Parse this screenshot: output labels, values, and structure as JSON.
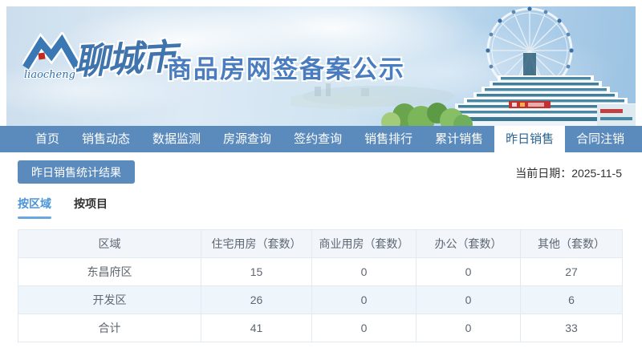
{
  "banner": {
    "logo_script": "liaocheng",
    "brand": "聊城市",
    "title": "商品房网签备案公示"
  },
  "nav": {
    "items": [
      {
        "label": "首页",
        "active": false
      },
      {
        "label": "销售动态",
        "active": false
      },
      {
        "label": "数据监测",
        "active": false
      },
      {
        "label": "房源查询",
        "active": false
      },
      {
        "label": "签约查询",
        "active": false
      },
      {
        "label": "销售排行",
        "active": false
      },
      {
        "label": "累计销售",
        "active": false
      },
      {
        "label": "昨日销售",
        "active": true
      },
      {
        "label": "合同注销",
        "active": false
      }
    ]
  },
  "content": {
    "section_title": "昨日销售统计结果",
    "date_label": "当前日期：",
    "date_value": "2025-11-5",
    "tabs": [
      {
        "label": "按区域",
        "active": true
      },
      {
        "label": "按项目",
        "active": false
      }
    ]
  },
  "table": {
    "headers": [
      "区域",
      "住宅用房（套数）",
      "商业用房（套数）",
      "办公（套数）",
      "其他（套数）"
    ],
    "rows": [
      {
        "cells": [
          "东昌府区",
          "15",
          "0",
          "0",
          "27"
        ]
      },
      {
        "cells": [
          "开发区",
          "26",
          "0",
          "0",
          "6"
        ]
      },
      {
        "cells": [
          "合计",
          "41",
          "0",
          "0",
          "33"
        ]
      }
    ]
  },
  "colors": {
    "nav_blue": "#5b8abd",
    "nav_active_text": "#2a6496",
    "tab_active_blue": "#4a94d8",
    "title_blue": "#4a7cc0",
    "table_border": "#e3e9f1",
    "table_header_bg": "#f2f5fa",
    "striped_row_bg": "#eef6fc"
  }
}
